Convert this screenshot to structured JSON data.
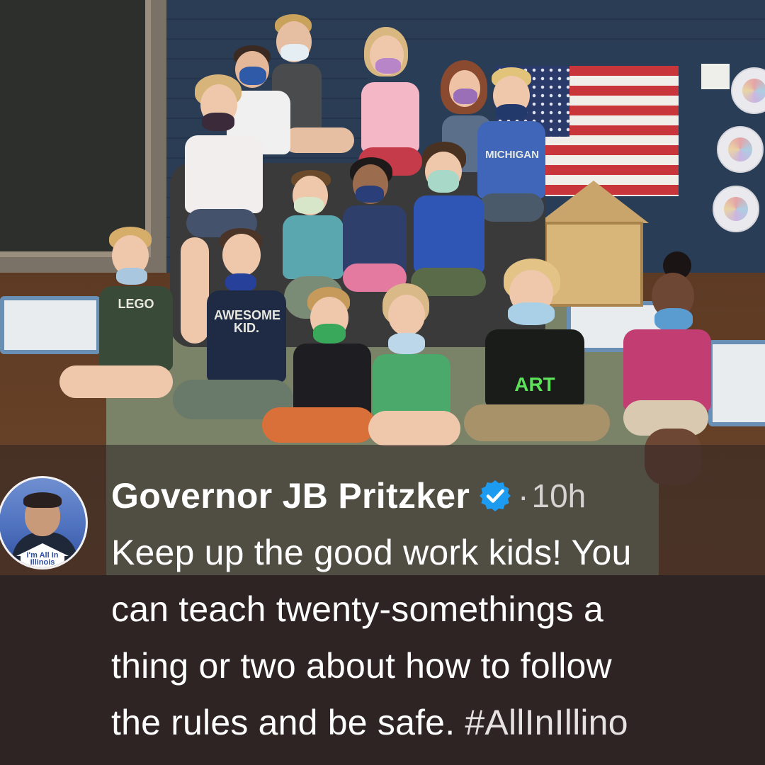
{
  "tweet": {
    "display_name": "Governor JB Pritzker",
    "dot": "·",
    "timestamp": "10h",
    "lines": [
      "Keep up the good work kids! You",
      "can teach twenty-somethings a",
      "thing or two about how to follow",
      "the rules and be safe. "
    ],
    "hashtag": "#AllInIllino",
    "avatar_badge_text": "I'm All In Illinois"
  },
  "photo": {
    "shirt_texts": [
      "LEGO",
      "AWESOME KID.",
      "ART",
      "MICHIGAN"
    ]
  },
  "colors": {
    "background": "#2e2424",
    "text": "#ffffff",
    "verified_badge": "#1d9bf0"
  },
  "icons": {
    "verified": "verified-badge-icon"
  }
}
